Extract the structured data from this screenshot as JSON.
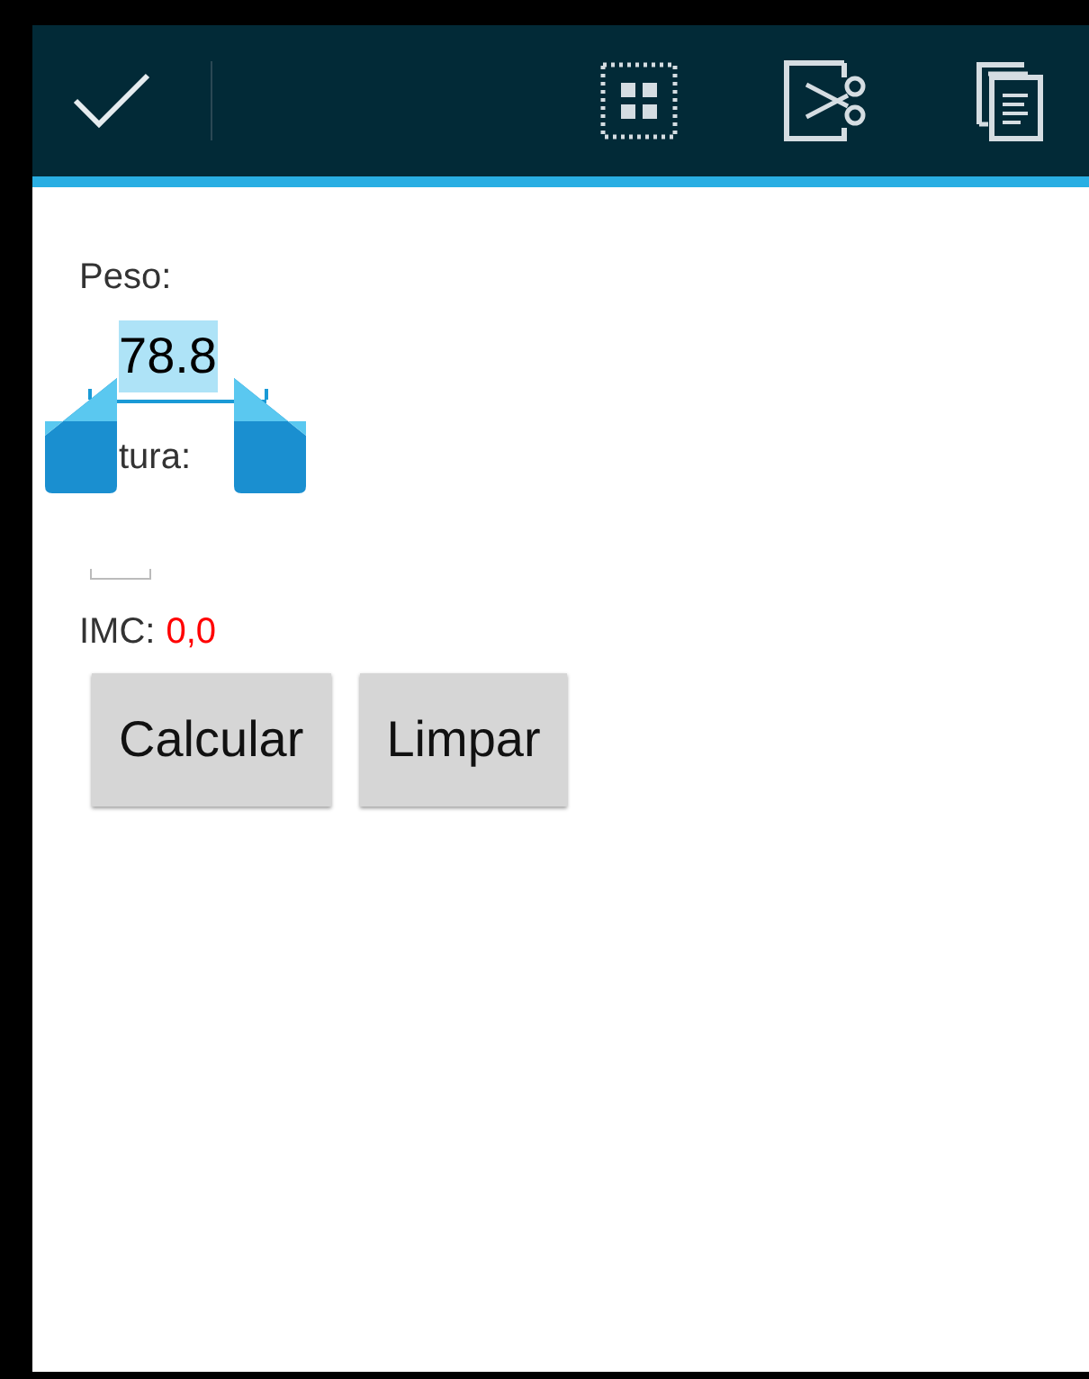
{
  "action_bar": {
    "done": true,
    "actions": [
      {
        "kind": "select_all"
      },
      {
        "kind": "cut"
      },
      {
        "kind": "copy"
      }
    ]
  },
  "form": {
    "peso": {
      "label": "Peso:",
      "value": "78.8",
      "selected": true
    },
    "altura": {
      "label": "tura:"
    },
    "imc": {
      "label": "IMC:",
      "value": "0,0"
    }
  },
  "buttons": [
    "Calcular",
    "Limpar"
  ]
}
